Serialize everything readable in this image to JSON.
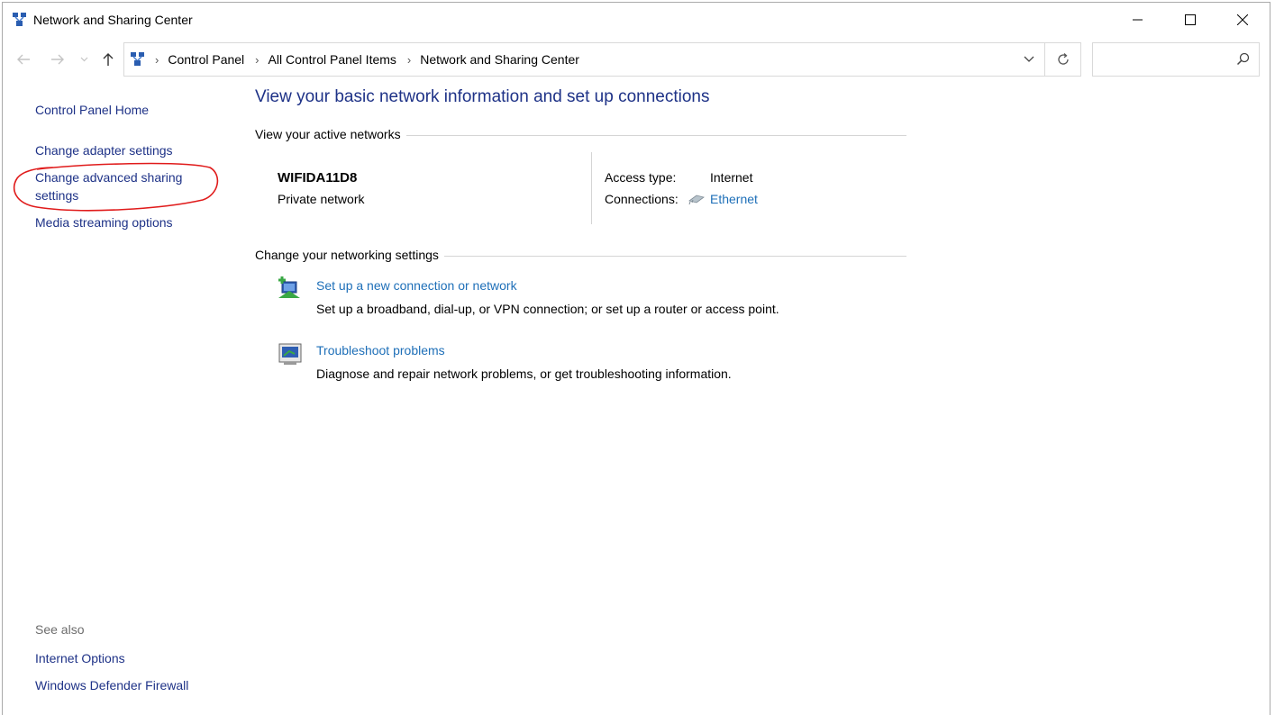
{
  "window": {
    "title": "Network and Sharing Center"
  },
  "address": {
    "crumbs": [
      "Control Panel",
      "All Control Panel Items",
      "Network and Sharing Center"
    ],
    "search_placeholder": ""
  },
  "left_pane": {
    "home": "Control Panel Home",
    "links": [
      "Change adapter settings",
      "Change advanced sharing settings",
      "Media streaming options"
    ],
    "see_also_heading": "See also",
    "see_also": [
      "Internet Options",
      "Windows Defender Firewall"
    ]
  },
  "main": {
    "title": "View your basic network information and set up connections",
    "active_networks_heading": "View your active networks",
    "network": {
      "name": "WIFIDA11D8",
      "type": "Private network",
      "access_type_label": "Access type:",
      "access_type_value": "Internet",
      "connections_label": "Connections:",
      "connection_link": "Ethernet"
    },
    "settings_heading": "Change your networking settings",
    "tasks": [
      {
        "link": "Set up a new connection or network",
        "description": "Set up a broadband, dial-up, or VPN connection; or set up a router or access point.",
        "icon": "new-connection-icon"
      },
      {
        "link": "Troubleshoot problems",
        "description": "Diagnose and repair network problems, or get troubleshooting information.",
        "icon": "troubleshoot-icon"
      }
    ]
  },
  "colors": {
    "link": "#1e6fb8",
    "nav_link": "#1e3287",
    "annotation": "#e01b1b"
  }
}
